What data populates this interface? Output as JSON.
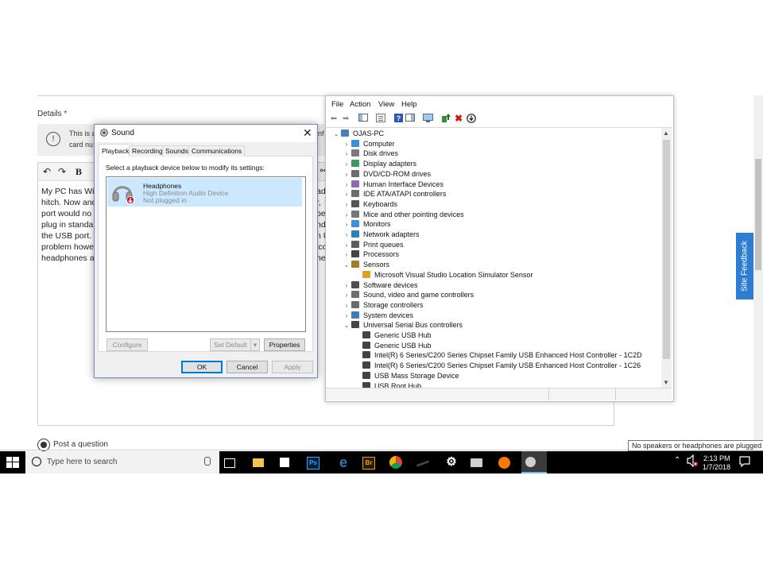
{
  "web_page": {
    "details_label": "Details",
    "required_mark": "*",
    "info_banner": {
      "line1": "This is a",
      "line2": "card nu",
      "line1_right": "inf"
    },
    "editor_toolbar": [
      "↶",
      "↷",
      "B"
    ],
    "editor_lines_left": [
      "My PC has Wir",
      "hitch. Now and",
      "port would no",
      "plug in standa",
      "the USB port. I",
      "problem howe",
      "headphones a"
    ],
    "editor_lines_right": [
      "ad",
      "r,",
      "pe",
      "nd",
      "n U",
      "icc",
      "he"
    ],
    "post_option_label": "Post a question",
    "site_feedback": "Site Feedback",
    "tooltip": "No speakers or headphones are plugged in."
  },
  "device_manager": {
    "menu": [
      "File",
      "Action",
      "View",
      "Help"
    ],
    "tree": [
      {
        "label": "OJAS-PC",
        "level": 0,
        "expanded": true,
        "icon": "computer-icon"
      },
      {
        "label": "Computer",
        "level": 1,
        "expanded": false,
        "icon": "monitor-icon"
      },
      {
        "label": "Disk drives",
        "level": 1,
        "expanded": false,
        "icon": "disk-icon"
      },
      {
        "label": "Display adapters",
        "level": 1,
        "expanded": false,
        "icon": "display-adapter-icon"
      },
      {
        "label": "DVD/CD-ROM drives",
        "level": 1,
        "expanded": false,
        "icon": "dvd-icon"
      },
      {
        "label": "Human Interface Devices",
        "level": 1,
        "expanded": false,
        "icon": "hid-icon"
      },
      {
        "label": "IDE ATA/ATAPI controllers",
        "level": 1,
        "expanded": false,
        "icon": "ide-icon"
      },
      {
        "label": "Keyboards",
        "level": 1,
        "expanded": false,
        "icon": "keyboard-icon"
      },
      {
        "label": "Mice and other pointing devices",
        "level": 1,
        "expanded": false,
        "icon": "mouse-icon"
      },
      {
        "label": "Monitors",
        "level": 1,
        "expanded": false,
        "icon": "monitor-icon"
      },
      {
        "label": "Network adapters",
        "level": 1,
        "expanded": false,
        "icon": "network-icon"
      },
      {
        "label": "Print queues",
        "level": 1,
        "expanded": false,
        "icon": "printer-icon"
      },
      {
        "label": "Processors",
        "level": 1,
        "expanded": false,
        "icon": "processor-icon"
      },
      {
        "label": "Sensors",
        "level": 1,
        "expanded": true,
        "icon": "sensor-icon"
      },
      {
        "label": "Microsoft Visual Studio Location Simulator Sensor",
        "level": 2,
        "icon": "sensor-device-icon"
      },
      {
        "label": "Software devices",
        "level": 1,
        "expanded": false,
        "icon": "software-icon"
      },
      {
        "label": "Sound, video and game controllers",
        "level": 1,
        "expanded": false,
        "icon": "speaker-icon"
      },
      {
        "label": "Storage controllers",
        "level": 1,
        "expanded": false,
        "icon": "storage-icon"
      },
      {
        "label": "System devices",
        "level": 1,
        "expanded": false,
        "icon": "system-icon"
      },
      {
        "label": "Universal Serial Bus controllers",
        "level": 1,
        "expanded": true,
        "icon": "usb-icon"
      },
      {
        "label": "Generic USB Hub",
        "level": 2,
        "icon": "usb-icon"
      },
      {
        "label": "Generic USB Hub",
        "level": 2,
        "icon": "usb-icon"
      },
      {
        "label": "Intel(R) 6 Series/C200 Series Chipset Family USB Enhanced Host Controller - 1C2D",
        "level": 2,
        "icon": "usb-icon"
      },
      {
        "label": "Intel(R) 6 Series/C200 Series Chipset Family USB Enhanced Host Controller - 1C26",
        "level": 2,
        "icon": "usb-icon"
      },
      {
        "label": "USB Mass Storage Device",
        "level": 2,
        "icon": "usb-icon"
      },
      {
        "label": "USB Root Hub",
        "level": 2,
        "icon": "usb-icon"
      }
    ],
    "icon_colors": {
      "computer-icon": "#4a7fc0",
      "monitor-icon": "#3f8fd8",
      "disk-icon": "#7a7a7a",
      "display-adapter-icon": "#3a9a5b",
      "dvd-icon": "#6d6d6d",
      "hid-icon": "#8c6bb1",
      "ide-icon": "#6d6d6d",
      "keyboard-icon": "#555555",
      "mouse-icon": "#777777",
      "network-icon": "#2f7fbf",
      "printer-icon": "#5c5c5c",
      "processor-icon": "#444444",
      "sensor-icon": "#a07b2c",
      "sensor-device-icon": "#d8a325",
      "software-icon": "#4d4d4d",
      "speaker-icon": "#6f6f6f",
      "storage-icon": "#6b6b6b",
      "system-icon": "#3d7ab8",
      "usb-icon": "#444444"
    }
  },
  "sound_dialog": {
    "title": "Sound",
    "tabs": [
      "Playback",
      "Recording",
      "Sounds",
      "Communications"
    ],
    "active_tab": "Playback",
    "instruction": "Select a playback device below to modify its settings:",
    "device": {
      "name": "Headphones",
      "description": "High Definition Audio Device",
      "status": "Not plugged in"
    },
    "buttons": {
      "configure": "Configure",
      "set_default": "Set Default",
      "properties": "Properties",
      "ok": "OK",
      "cancel": "Cancel",
      "apply": "Apply"
    }
  },
  "taskbar": {
    "search_placeholder": "Type here to search",
    "apps": [
      {
        "name": "task-view-icon",
        "label": ""
      },
      {
        "name": "file-explorer-icon",
        "label": ""
      },
      {
        "name": "store-icon",
        "label": ""
      },
      {
        "name": "photoshop-icon",
        "label": "Ps"
      },
      {
        "name": "edge-icon",
        "label": "e"
      },
      {
        "name": "bridge-icon",
        "label": "Br"
      },
      {
        "name": "chrome-icon",
        "label": ""
      },
      {
        "name": "pen-app-icon",
        "label": ""
      },
      {
        "name": "settings-icon",
        "label": "⚙"
      },
      {
        "name": "device-app-icon",
        "label": ""
      },
      {
        "name": "avast-icon",
        "label": ""
      },
      {
        "name": "sound-app-icon",
        "label": ""
      }
    ],
    "clock_time": "2:13 PM",
    "clock_date": "1/7/2018"
  }
}
